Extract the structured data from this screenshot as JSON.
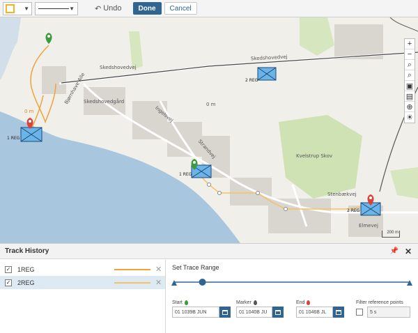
{
  "toolbar": {
    "color_swatch": "#f0b323",
    "undo_label": "Undo",
    "done_label": "Done",
    "cancel_label": "Cancel"
  },
  "map": {
    "labels": {
      "skedshovedvej_top": "Skedshovedvej",
      "skedshovedvej_left": "Skedshovedvej",
      "skedshovedgard": "Skedshovedgård",
      "bjornhave": "Bjørnhave Alle",
      "ingelsvej": "Ingelsvej",
      "strandvej": "Strandvej",
      "elmevej": "Elmevej",
      "kvelstrup": "Kvelstrup Skov",
      "stenbaekvej": "Stenbækvej",
      "elevation_top": "0 m",
      "elevation_left": "0 m",
      "dist_label": "0 m"
    },
    "units": {
      "u1": "1 REG",
      "u2": "2 REG",
      "u3": "1 REG",
      "u4": "2 REG"
    },
    "scale_label": "200 m",
    "controls": [
      "zoom-in",
      "zoom-out",
      "zoom-area",
      "zoom-out-area",
      "fit",
      "layers",
      "globe",
      "brightness"
    ]
  },
  "track_history": {
    "title": "Track History",
    "tracks": [
      {
        "name": "1REG",
        "checked": true,
        "color": "#f0a23a"
      },
      {
        "name": "2REG",
        "checked": true,
        "color": "#f7c060"
      }
    ]
  },
  "trace_range": {
    "title": "Set Trace Range",
    "start_label": "Start",
    "start_value": "01 1039B JUN",
    "marker_label": "Marker",
    "marker_value": "01 1040B JU",
    "end_label": "End",
    "end_value": "01 1046B JL",
    "filter_label": "Filter reference points",
    "filter_value": "5 s",
    "slider_position": 0.12
  },
  "colors": {
    "accent": "#2f6590",
    "start_pin": "#3c9b3c",
    "marker_pin": "#555555",
    "end_pin": "#d9443a",
    "water": "#a9c6df",
    "forest": "#cfe2b4"
  }
}
